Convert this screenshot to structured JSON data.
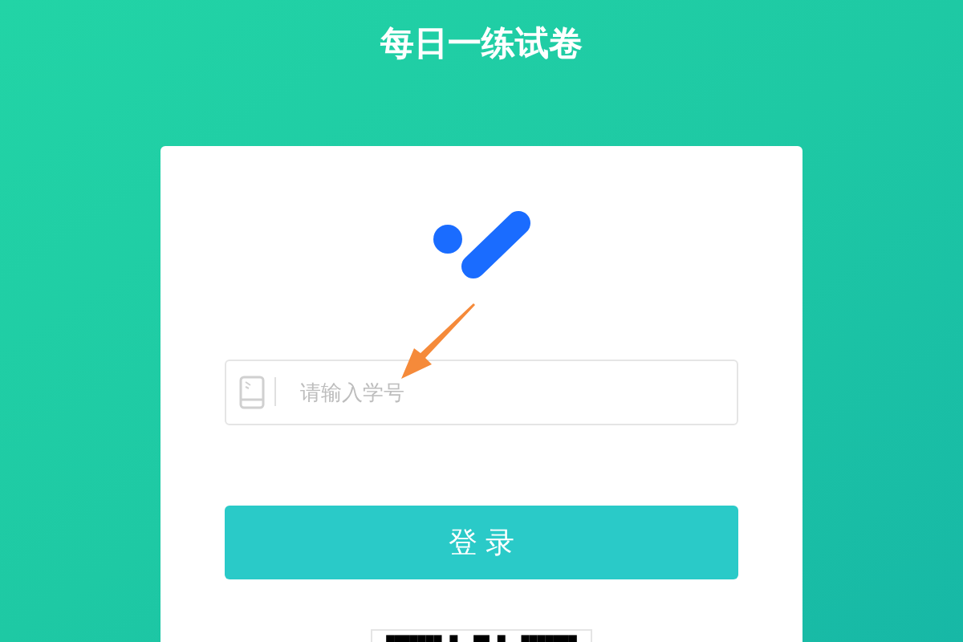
{
  "title": "每日一练试卷",
  "login_form": {
    "student_id_field": {
      "placeholder": "请输入学号"
    },
    "login_button": "登 录"
  }
}
